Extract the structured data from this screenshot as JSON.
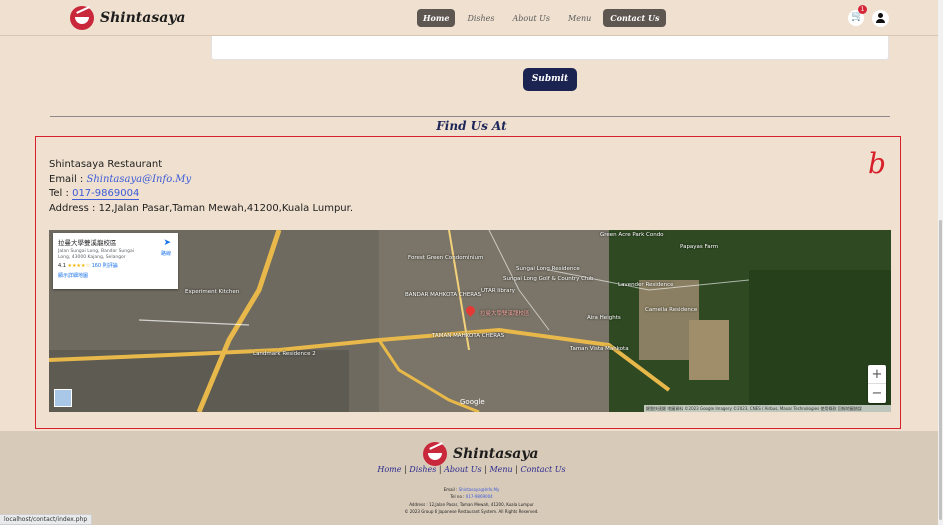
{
  "header": {
    "brand": "Shintasaya",
    "nav": [
      "Home",
      "Dishes",
      "About Us",
      "Menu",
      "Contact Us"
    ],
    "cart_count": "1"
  },
  "form": {
    "submit_label": "Submit"
  },
  "find_us": {
    "title": "Find Us At",
    "annotation": "b",
    "restaurant_name": "Shintasaya Restaurant",
    "email_label": "Email :",
    "email": "Shintasaya@Info.My",
    "tel_label": "Tel :",
    "tel": "017-9869004",
    "address_label": "Address :",
    "address": "12,Jalan Pasar,Taman Mewah,41200,Kuala Lumpur."
  },
  "map": {
    "place_name": "拉曼大學雙溪龍校區",
    "place_address": "Jalan Sungai Long, Bandar Sungai Long, 43000 Kajang, Selangor",
    "rating": "4.1",
    "stars": "★★★★☆",
    "reviews": "160 則評論",
    "view_larger": "顯示詳細地圖",
    "directions": "路線",
    "zoom_in": "+",
    "zoom_out": "−",
    "google": "Google",
    "attribution": "鍵盤快速鍵  地圖資料 ©2023 Google Imagery ©2023, CNES / Airbus, Maxar Technologies  使用條款  回報地圖錯誤",
    "labels": {
      "bandar_mahkota": "BANDAR MAHKOTA CHERAS",
      "utar_library": "UTAR library",
      "sungai_long_residence": "Sungai Long Residence",
      "forest_green": "Forest Green Condominium",
      "green_acre": "Green Acre Park Condo",
      "papayas_farm": "Papayas Farm",
      "lavender": "Lavender Residence",
      "cameila": "Cameila Residence",
      "experiment_kitchen": "Experiment Kitchen",
      "landmark_residence": "Landmark Residence 2",
      "aira_heights": "Aira Heights",
      "taman_vista": "Taman Vista Mahkota",
      "taman_mahkota": "TAMAN MAHKOTA CHERAS",
      "sungai_long_golf": "Sungai Long Golf & Country Club",
      "pin": "拉曼大學雙溪龍校區"
    }
  },
  "footer": {
    "brand": "Shintasaya",
    "links": [
      "Home",
      "Dishes",
      "About Us",
      "Menu",
      "Contact Us"
    ],
    "email_label": "Email :",
    "email": "Shintasaya@Info.My",
    "tel_label": "Tel no :",
    "tel": "017-9869004",
    "address": "Address : 12,Jalan Pasar, Taman Mewah, 41200, Kuala Lumpur",
    "copyright": "© 2023 Group 6 Japanese Restaurant System. All Rights Reserved."
  },
  "status_url": "localhost/contact/index.php"
}
